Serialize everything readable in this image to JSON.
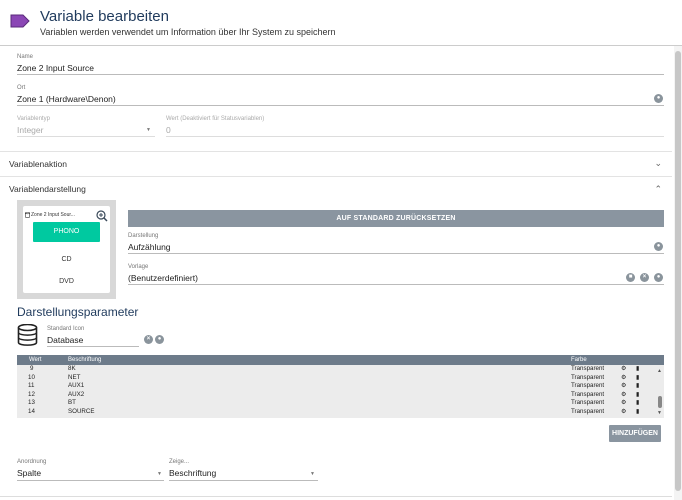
{
  "header": {
    "title": "Variable bearbeiten",
    "subtitle": "Variablen werden verwendet um Information über Ihr System zu speichern"
  },
  "fields": {
    "name": {
      "label": "Name",
      "value": "Zone 2 Input Source"
    },
    "ort": {
      "label": "Ort",
      "value": "Zone 1 (Hardware\\Denon)"
    },
    "variablentyp": {
      "label": "Variablentyp",
      "value": "Integer"
    },
    "wert": {
      "label": "Wert (Deaktiviert für Statusvariablen)",
      "value": "0"
    }
  },
  "sections": {
    "aktion": "Variablenaktion",
    "darstellung": "Variablendarstellung"
  },
  "preview": {
    "title": "Zone 2 Input Sour...",
    "options": [
      "PHONO",
      "CD",
      "DVD"
    ],
    "active_color": "#00c9a0"
  },
  "reset_button": "AUF STANDARD ZURÜCKSETZEN",
  "darstellung": {
    "label": "Darstellung",
    "value": "Aufzählung"
  },
  "vorlage": {
    "label": "Vorlage",
    "value": "(Benutzerdefiniert)"
  },
  "params": {
    "title": "Darstellungsparameter",
    "icon_label": "Standard Icon",
    "icon_value": "Database"
  },
  "table": {
    "columns": [
      "Wert",
      "Beschriftung",
      "Farbe"
    ],
    "rows": [
      {
        "wert": "9",
        "label": "8K",
        "farbe": "Transparent"
      },
      {
        "wert": "10",
        "label": "NET",
        "farbe": "Transparent"
      },
      {
        "wert": "11",
        "label": "AUX1",
        "farbe": "Transparent"
      },
      {
        "wert": "12",
        "label": "AUX2",
        "farbe": "Transparent"
      },
      {
        "wert": "13",
        "label": "BT",
        "farbe": "Transparent"
      },
      {
        "wert": "14",
        "label": "SOURCE",
        "farbe": "Transparent"
      }
    ]
  },
  "add_button": "HINZUFÜGEN",
  "anordnung": {
    "label": "Anordnung",
    "value": "Spalte"
  },
  "zeige": {
    "label": "Zeige...",
    "value": "Beschriftung"
  },
  "colors": {
    "accent": "#00c9a0",
    "title_blue": "#1f3a5c",
    "button_grey": "#8a95a0",
    "table_header": "#6d7b8a",
    "tag_purple": "#7a3ea3"
  }
}
